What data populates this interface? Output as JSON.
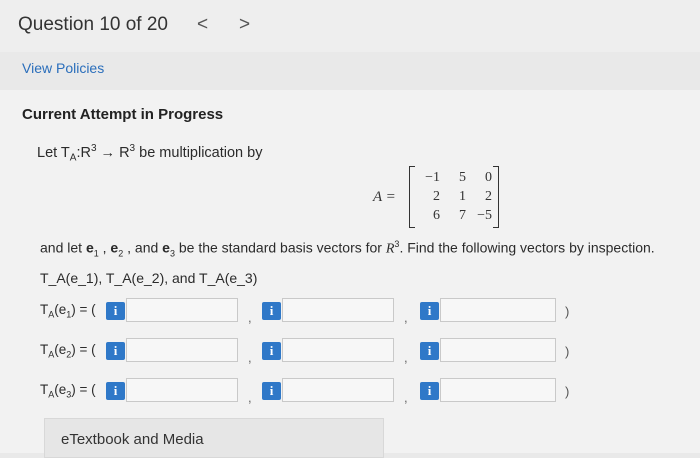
{
  "header": {
    "question_label": "Question 10 of 20",
    "prev_icon": "chevron-left-icon",
    "next_icon": "chevron-right-icon",
    "prev_glyph": "<",
    "next_glyph": ">"
  },
  "policies_link": "View Policies",
  "attempt_heading": "Current Attempt in Progress",
  "problem": {
    "intro_prefix": "Let T",
    "intro_sub": "A",
    "intro_mid": ":R",
    "intro_sup1": "3",
    "intro_arrow": " → R",
    "intro_sup2": "3",
    "intro_suffix": " be multiplication by",
    "matrix_lhs": "A =",
    "matrix": [
      [
        "−1",
        "5",
        "0"
      ],
      [
        "2",
        "1",
        "2"
      ],
      [
        "6",
        "7",
        "−5"
      ]
    ],
    "basis_text_1": "and let ",
    "e1": "e",
    "e1_sub": "1",
    "sep1": " , ",
    "e2": "e",
    "e2_sub": "2",
    "sep2": " , and ",
    "e3": "e",
    "e3_sub": "3",
    "basis_text_2": " be the standard basis vectors for ",
    "basis_space": "R",
    "basis_sup": "3",
    "basis_text_3": ". Find the following vectors by inspection.",
    "targets_line": "T_A(e_1), T_A(e_2), and T_A(e_3)"
  },
  "answer_rows": [
    {
      "label": "T",
      "sub_a": "A",
      "mid": "(e",
      "sub_e": "1",
      "tail": ") = (",
      "close": ")"
    },
    {
      "label": "T",
      "sub_a": "A",
      "mid": "(e",
      "sub_e": "2",
      "tail": ") = (",
      "close": ")"
    },
    {
      "label": "T",
      "sub_a": "A",
      "mid": "(e",
      "sub_e": "3",
      "tail": ") = (",
      "close": ")"
    }
  ],
  "answer_inputs": [
    [
      "",
      "",
      ""
    ],
    [
      "",
      "",
      ""
    ],
    [
      "",
      "",
      ""
    ]
  ],
  "info_button_text": "i",
  "info_icon": "info-icon",
  "comma_text": ",",
  "etextbook_label": "eTextbook and Media",
  "colors": {
    "accent": "#2f78c8",
    "link": "#2a6ebb",
    "background": "#e9e9e9"
  }
}
